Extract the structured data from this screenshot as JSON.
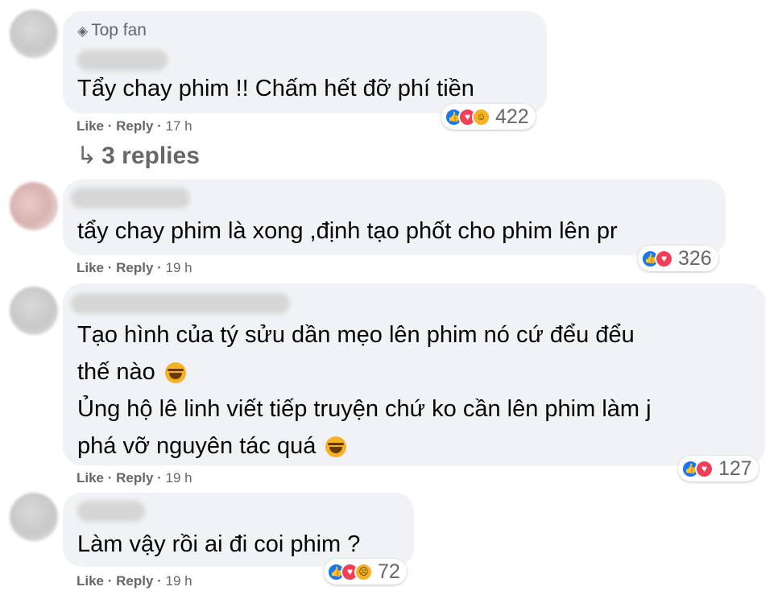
{
  "comments": [
    {
      "badge": "Top fan",
      "badge_icon": "diamond-icon",
      "lines": [
        "Tẩy chay phim !! Chấm hết đỡ phí tiền"
      ],
      "like": "Like",
      "reply": "Reply",
      "time": "17 h",
      "reactions": [
        "like",
        "love",
        "care"
      ],
      "count": "422",
      "replies_label": "3 replies"
    },
    {
      "lines": [
        "tẩy chay phim là xong ,định tạo phốt cho phim lên pr"
      ],
      "like": "Like",
      "reply": "Reply",
      "time": "19 h",
      "reactions": [
        "like",
        "love"
      ],
      "count": "326"
    },
    {
      "lines": [
        "Tạo hình của tý sửu dần mẹo lên phim nó cứ đểu đểu",
        "thế nào",
        "Ủng hộ lê linh viết tiếp truyện chứ ko cần lên phim làm j",
        "phá vỡ nguyên tác quá"
      ],
      "like": "Like",
      "reply": "Reply",
      "time": "19 h",
      "reactions": [
        "like",
        "love"
      ],
      "count": "127"
    },
    {
      "lines": [
        "Làm vậy rồi ai đi coi phim ?"
      ],
      "like": "Like",
      "reply": "Reply",
      "time": "19 h",
      "reactions": [
        "like",
        "love",
        "sad"
      ],
      "count": "72"
    }
  ],
  "separator": " · ",
  "reply_arrow": "↳",
  "colors": {
    "bubble": "#f0f2f5",
    "meta_text": "#65676b",
    "like_blue": "#1877f2",
    "love_red": "#f33e58",
    "emoji_yellow": "#f7b125"
  }
}
